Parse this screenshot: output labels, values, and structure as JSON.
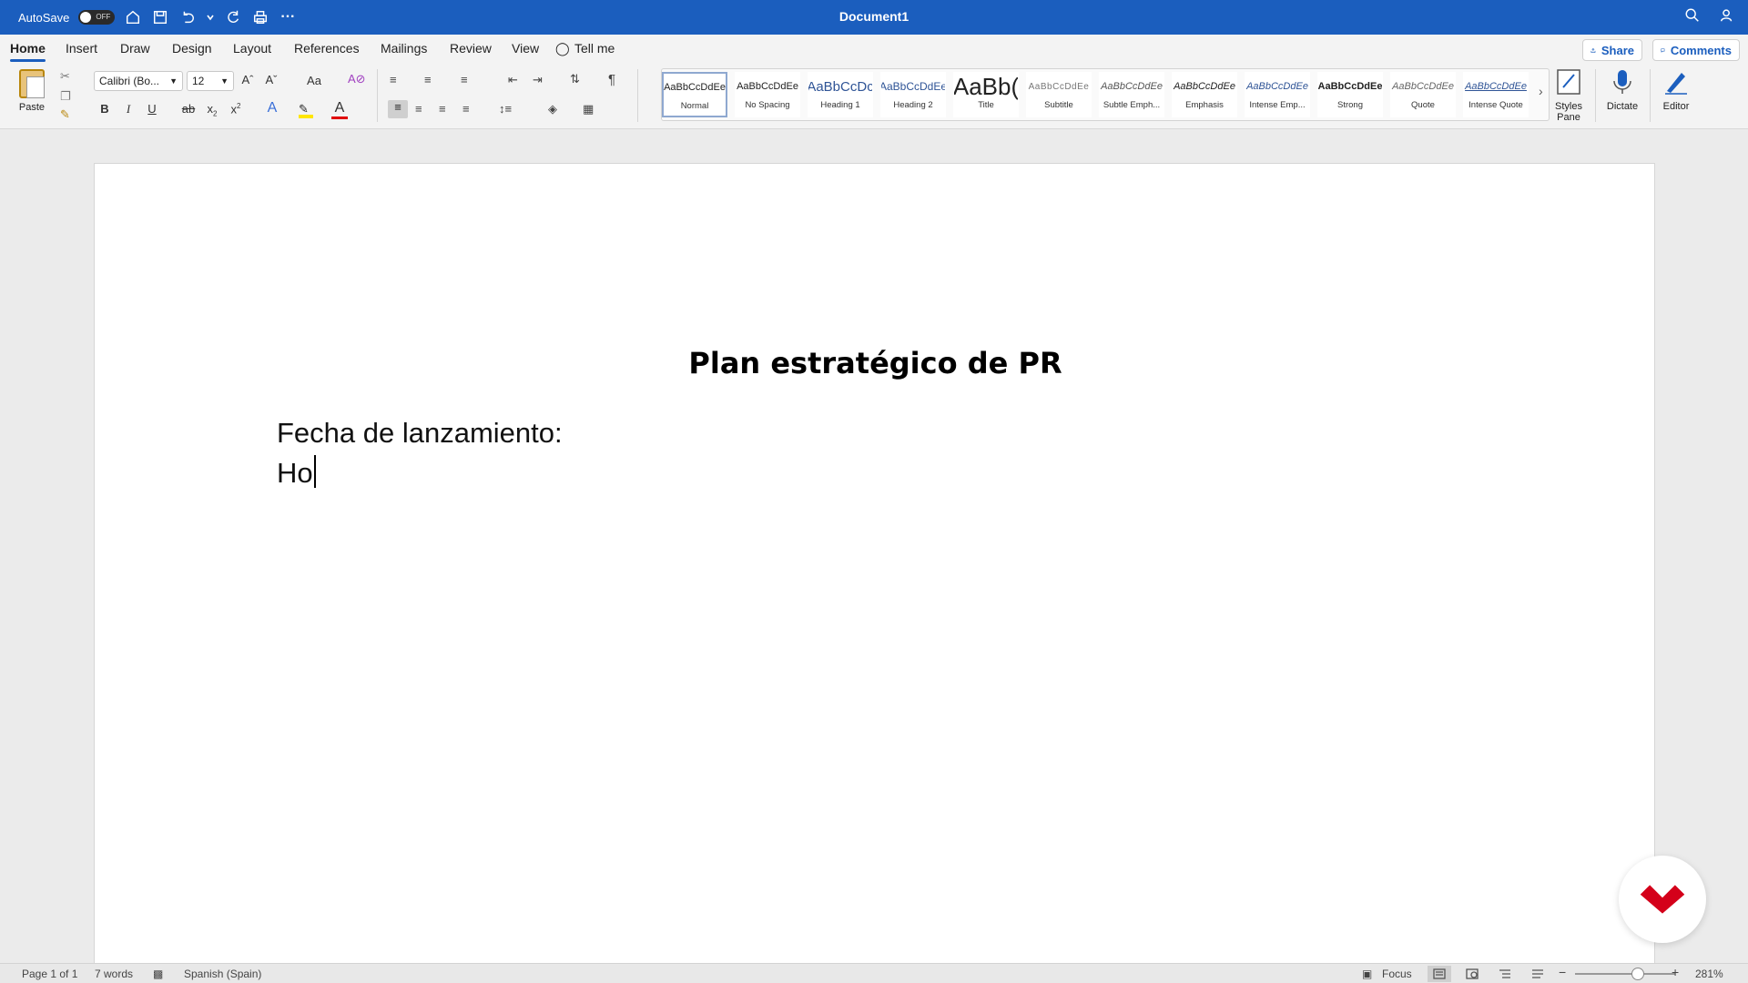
{
  "titlebar": {
    "autosave_label": "AutoSave",
    "autosave_state": "OFF",
    "document_title": "Document1"
  },
  "tabs": [
    {
      "label": "Home"
    },
    {
      "label": "Insert"
    },
    {
      "label": "Draw"
    },
    {
      "label": "Design"
    },
    {
      "label": "Layout"
    },
    {
      "label": "References"
    },
    {
      "label": "Mailings"
    },
    {
      "label": "Review"
    },
    {
      "label": "View"
    },
    {
      "label": "Tell me"
    }
  ],
  "actions": {
    "share": "Share",
    "comments": "Comments"
  },
  "ribbon": {
    "paste_label": "Paste",
    "font_name": "Calibri (Bo...",
    "font_size": "12",
    "change_case": "Aa",
    "bold": "B",
    "italic": "I",
    "underline": "U",
    "strike": "ab",
    "subscript": "x",
    "superscript": "x",
    "styles_pane": "Styles Pane",
    "dictate": "Dictate",
    "editor": "Editor"
  },
  "styles": [
    {
      "sample": "AaBbCcDdEe",
      "name": "Normal"
    },
    {
      "sample": "AaBbCcDdEe",
      "name": "No Spacing"
    },
    {
      "sample": "AaBbCcDc",
      "name": "Heading 1"
    },
    {
      "sample": "AaBbCcDdEe",
      "name": "Heading 2"
    },
    {
      "sample": "AaBb(",
      "name": "Title"
    },
    {
      "sample": "AaBbCcDdEe",
      "name": "Subtitle"
    },
    {
      "sample": "AaBbCcDdEe",
      "name": "Subtle Emph..."
    },
    {
      "sample": "AaBbCcDdEe",
      "name": "Emphasis"
    },
    {
      "sample": "AaBbCcDdEe",
      "name": "Intense Emp..."
    },
    {
      "sample": "AaBbCcDdEe",
      "name": "Strong"
    },
    {
      "sample": "AaBbCcDdEe",
      "name": "Quote"
    },
    {
      "sample": "AaBbCcDdEe",
      "name": "Intense Quote"
    }
  ],
  "document": {
    "heading": "Plan estratégico de PR",
    "line1": "Fecha de lanzamiento:",
    "line2": "Ho"
  },
  "statusbar": {
    "page": "Page 1 of 1",
    "words": "7 words",
    "language": "Spanish (Spain)",
    "focus": "Focus",
    "zoom": "281%"
  },
  "colors": {
    "accent": "#1b5ebe",
    "fab_logo": "#d4001a",
    "highlight": "#ffe600",
    "font_color": "#e00000"
  }
}
